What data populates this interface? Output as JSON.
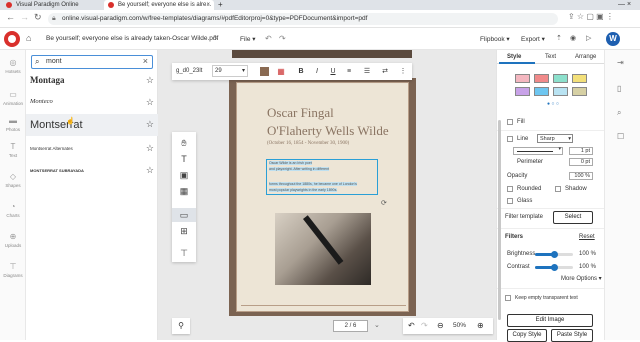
{
  "browser": {
    "tabs": [
      {
        "label": "Visual Paradigm Online"
      },
      {
        "label": "Be yourself; everyone else is alre..."
      }
    ],
    "new_tab": "+",
    "url": "online.visual-paradigm.com/w/free-templates/diagrams/#pdfEditorproj=0&type=PDFDocument&import=pdf"
  },
  "app": {
    "doc_title": "Be yourself; everyone else is already taken-Oscar Wilde.pdf",
    "file_menu": "File",
    "flipbook": "Flipbook",
    "export": "Export",
    "avatar": "W"
  },
  "rail": [
    "Hotsets",
    "Animation",
    "Photos",
    "Text",
    "Shapes",
    "Charts",
    "Uploads",
    "Diagrams"
  ],
  "font_panel": {
    "search_value": "mont",
    "fonts": [
      {
        "label": "Montaga"
      },
      {
        "label": "Monteco"
      },
      {
        "label": "Montserrat"
      },
      {
        "label": "Montserrat Alternates"
      },
      {
        "label": "MONTSERRAT SUBRAYADA"
      }
    ]
  },
  "toolbar": {
    "font": "g_d0_23lt",
    "size": "29",
    "bold": "B",
    "italic": "I",
    "underline": "U"
  },
  "page": {
    "title_line1": "Oscar Fingal",
    "title_line2": "O'Flaherty Wells Wilde",
    "dates": "(October 16, 1854 - November 30, 1900)",
    "body_lines": [
      "Oscar Wilde is an Irish poet",
      "and playwright. After writing in different",
      "forms throughout the 1880s, he became one of London's",
      "most popular playwrights in the early 1890s."
    ]
  },
  "pager": {
    "page": "2 / 6",
    "zoom": "50%"
  },
  "right_panel": {
    "tabs": [
      "Style",
      "Text",
      "Arrange"
    ],
    "swatches": [
      "#f4b7c0",
      "#f08a8a",
      "#8ce0cc",
      "#f3e07a",
      "#c8a2e8",
      "#6ec6f0",
      "#b9e3f2",
      "#d6d0a4"
    ],
    "fill": "Fill",
    "line": "Line",
    "line_style": "Sharp",
    "line_width": "1 pt",
    "perimeter": "Perimeter",
    "perimeter_val": "0 pt",
    "opacity": "Opacity",
    "opacity_val": "100 %",
    "rounded": "Rounded",
    "shadow": "Shadow",
    "glass": "Glass",
    "filter_template": "Filter template",
    "select": "Select",
    "filters": "Filters",
    "reset": "Reset",
    "brightness": "Brightness",
    "brightness_val": "100 %",
    "brightness_level": 0.5,
    "contrast": "Contrast",
    "contrast_val": "100 %",
    "contrast_level": 0.5,
    "more_options": "More Options",
    "keep_transparent": "Keep empty transparent text",
    "edit_image": "Edit Image",
    "copy_style": "Copy Style",
    "paste_style": "Paste Style"
  },
  "colors": {
    "accent": "#1e73be",
    "swatch_selected": "#1e73be",
    "brand_red": "#d9302c"
  }
}
